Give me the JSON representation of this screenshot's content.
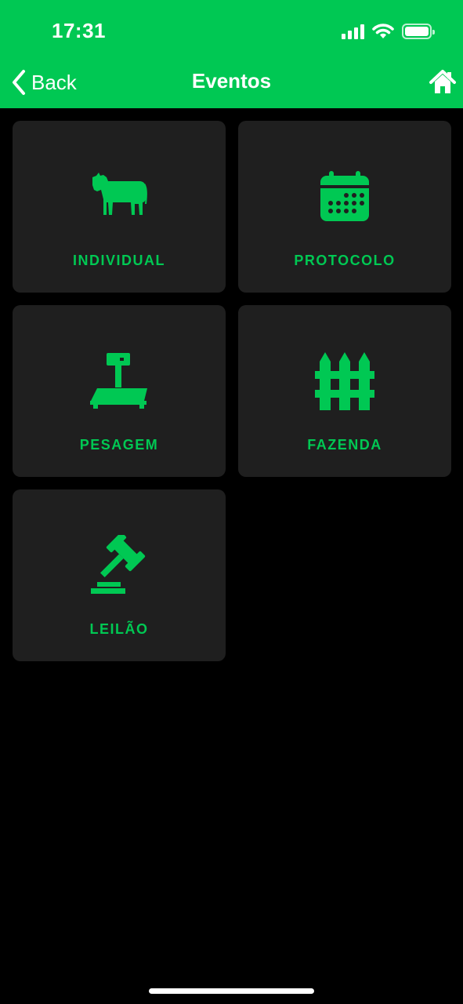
{
  "status_bar": {
    "time": "17:31"
  },
  "nav": {
    "back_label": "Back",
    "title": "Eventos"
  },
  "colors": {
    "accent": "#00C853",
    "card_bg": "#1F1F1F",
    "background": "#000000"
  },
  "cards": [
    {
      "label": "INDIVIDUAL",
      "icon": "cow-icon"
    },
    {
      "label": "PROTOCOLO",
      "icon": "calendar-icon"
    },
    {
      "label": "PESAGEM",
      "icon": "scale-icon"
    },
    {
      "label": "FAZENDA",
      "icon": "fence-icon"
    },
    {
      "label": "LEILÃO",
      "icon": "gavel-icon"
    }
  ]
}
